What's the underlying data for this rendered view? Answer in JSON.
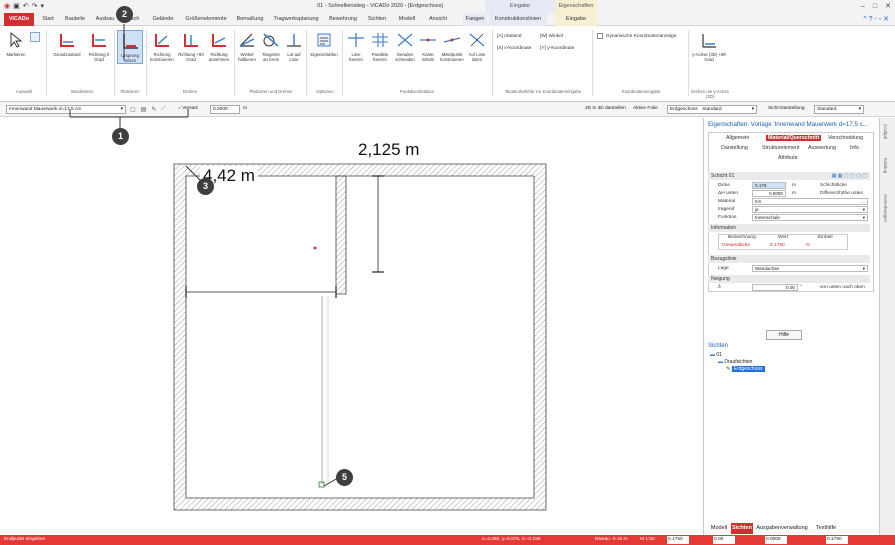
{
  "titlebar": {
    "title": "01 - Schnelleinstieg - ViCADo 2020 - [Erdgeschoss]",
    "context_eingabe": "Eingabe",
    "context_eigenschaften": "Eigenschaften"
  },
  "tabs": [
    {
      "label": "ViCADo"
    },
    {
      "label": "Start"
    },
    {
      "label": "Bauteile"
    },
    {
      "label": "Ausbau"
    },
    {
      "label": "Dach"
    },
    {
      "label": "Gelände"
    },
    {
      "label": "Größenelemente"
    },
    {
      "label": "Bemaßung"
    },
    {
      "label": "Tragwerksplanung"
    },
    {
      "label": "Bewehrung"
    },
    {
      "label": "Sichten"
    },
    {
      "label": "Modell"
    },
    {
      "label": "Ansicht"
    },
    {
      "label": "Fangen"
    },
    {
      "label": "Konstruktionslinien"
    },
    {
      "label": "Eingabe"
    }
  ],
  "ribbon": {
    "buttons": [
      {
        "label": "Markieren"
      },
      {
        "label": "Grundzustand"
      },
      {
        "label": "Richtung 0 Grad"
      },
      {
        "label": "Ursprung setzen"
      },
      {
        "label": "Richtung konstruieren"
      },
      {
        "label": "Richtung +90 Grad"
      },
      {
        "label": "Richtung annehmen"
      },
      {
        "label": "Winkel halbieren"
      },
      {
        "label": "Tangente an Kreis"
      },
      {
        "label": "Lot auf Linie"
      },
      {
        "label": "Eigenschaften"
      },
      {
        "label": "Linie fixieren"
      },
      {
        "label": "Parallele fixieren"
      },
      {
        "label": "Geraden schneiden"
      },
      {
        "label": "Kante mitteln"
      },
      {
        "label": "Mittelpunkt konstruieren"
      },
      {
        "label": "Auf Linie lotien"
      },
      {
        "label": "y-Achse (3D) +90 Grad"
      }
    ],
    "groups": [
      {
        "label": "Auswahl"
      },
      {
        "label": "Initialisieren"
      },
      {
        "label": "Platzieren"
      },
      {
        "label": "Drehen"
      },
      {
        "label": "Platzieren und Drehen"
      },
      {
        "label": "Optionen"
      },
      {
        "label": "Punktkonstruktion"
      },
      {
        "label": "Tastaturbefehle zur Koordinateneingabe"
      },
      {
        "label": "Koordinateneingabe"
      },
      {
        "label": "Drehen um y-Achse (3D)"
      }
    ],
    "keys": {
      "a_abstand": "[A] Abstand",
      "w_winkel": "[W] Winkel",
      "x_koord": "[X] x-Koordinate",
      "y_koord": "[Y] y-Koordinate",
      "dynamic": "Dynamische Koordinatenanzeige"
    }
  },
  "optbar": {
    "wall_type": "Innenwand Mauerwerk d=17.5 cm",
    "versatz_label": "= Versatz",
    "versatz_value": "0.0000",
    "versatz_unit": "m",
    "render_3d": "2D in 3D darstellen",
    "aktive_folie": "Aktive Folie",
    "layer": "Erdgeschoss",
    "layer_value": "Standard",
    "darstellung_label": "Sicht-Darstellung",
    "darstellung_value": "Standard"
  },
  "drawing": {
    "dim_horizontal": "4,42 m",
    "dim_vertical": "2,125 m"
  },
  "callouts": {
    "c1": "1",
    "c2": "2",
    "c3": "3",
    "c4": "4",
    "c5": "5"
  },
  "properties": {
    "title": "Eigenschaften: Vorlage 'Innenwand Mauerwerk d=17,5 c...",
    "tabs": [
      {
        "label": "Allgemein"
      },
      {
        "label": "Material/Querschnitt"
      },
      {
        "label": "Verschneidung"
      },
      {
        "label": "Darstellung"
      },
      {
        "label": "Strukturelement"
      },
      {
        "label": "Auswertung"
      },
      {
        "label": "Info"
      },
      {
        "label": "Attribute"
      }
    ],
    "schicht": {
      "header": "Schicht 01",
      "dicke_label": "Dicke",
      "dicke_value": "0.175",
      "dicke_unit": "m",
      "dicke_desc": "Schichtdicke",
      "dh_label": "ΔH unten",
      "dh_value": "0.0000",
      "dh_unit": "m",
      "dh_desc": "Differenzhöhe unten",
      "material_label": "Material",
      "material_value": "KS",
      "tragend_label": "tragend",
      "tragend_value": "ja",
      "funktion_label": "Funktion",
      "funktion_value": "Innenschale"
    },
    "information": {
      "header": "Information",
      "col_bez": "Bezeichnung",
      "col_wert": "Wert",
      "col_einheit": "Einheit",
      "row_bez": "Gesamtdicke",
      "row_wert": "0.1750",
      "row_einheit": "m"
    },
    "bezugslinie": {
      "header": "Bezugslinie",
      "lage_label": "Lage",
      "lage_value": "Wandachse"
    },
    "neigung": {
      "header": "Neigung",
      "delta_label": "δ",
      "delta_value": "0.00",
      "delta_unit": "°",
      "delta_desc": "von unten nach oben"
    },
    "help_button": "Hilfe"
  },
  "sichten": {
    "title": "Sichten",
    "node_root": "01",
    "node_draufsichten": "Draufsichten",
    "node_erdgeschoss": "Erdgeschoss"
  },
  "bottom_tabs": [
    {
      "label": "Modell"
    },
    {
      "label": "Sichten"
    },
    {
      "label": "Ausgabenverwaltung"
    },
    {
      "label": "Texthilfe"
    }
  ],
  "sidestrip": {
    "cockpit": "Cockpit",
    "katalog": "Katalog",
    "anmerkungen": "Anmerkungen"
  },
  "status": {
    "prompt": "Endpunkt eingeben",
    "coords": "x=4.285, y=5.875, z=-0.155",
    "niveau": "Niveau -0.15 m",
    "scale": "M 1:50",
    "f1": "0.1750",
    "f2": "0.00",
    "f3": "0.0000",
    "f4": "0.1750"
  },
  "colors": {
    "brand_red": "#d32f2f",
    "status_red": "#e53935",
    "callout": "#3f3f3f"
  }
}
